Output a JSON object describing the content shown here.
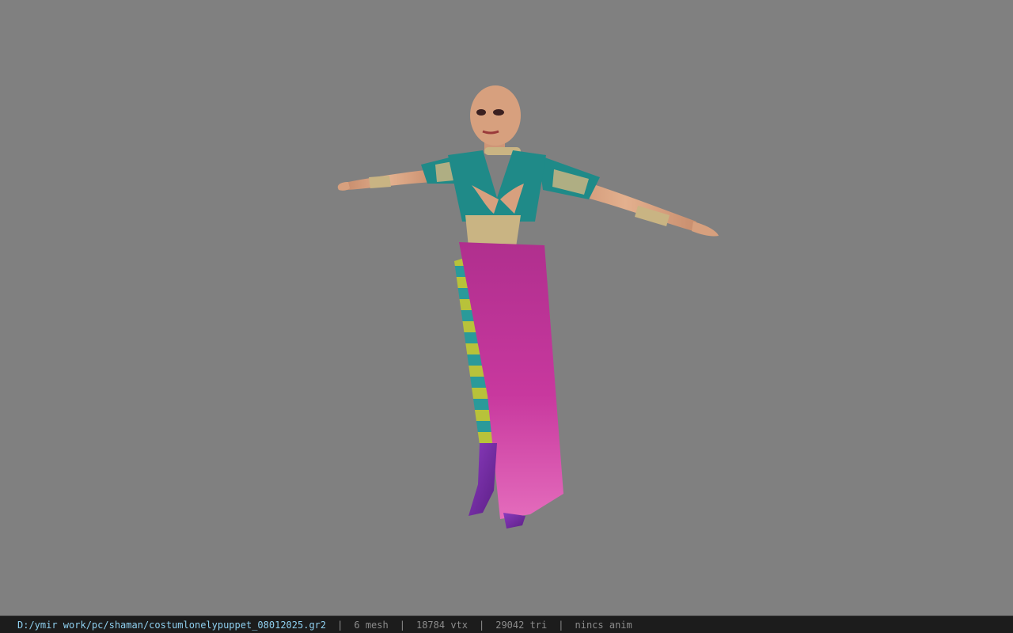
{
  "status_bar": {
    "file_path": "D:/ymir work/pc/shaman/costumlonelypuppet_08012025.gr2",
    "separator": "|",
    "mesh_count": "6 mesh",
    "vertex_count": "18784 vtx",
    "triangle_count": "29042 tri",
    "anim_status": "nincs anim"
  },
  "colors": {
    "viewport_bg": "#808080",
    "statusbar_bg": "#1c1c1c",
    "path_text": "#8fd0f0",
    "stat_text": "#8c8c8c",
    "skirt": "#c8389e",
    "bodice": "#1f8a88",
    "gold_trim": "#c9b483",
    "stripe_a": "#2a9a9a",
    "stripe_b": "#b8c23a",
    "boots": "#7a2ea8",
    "skin": "#d7a07e"
  }
}
